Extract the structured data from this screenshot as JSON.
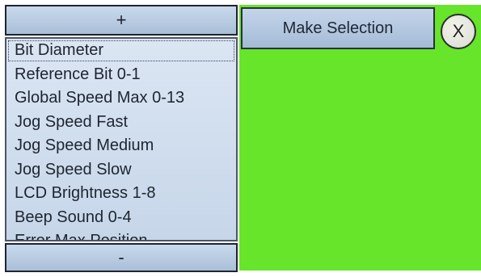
{
  "list": {
    "scroll_up_label": "+",
    "scroll_down_label": "-",
    "items": [
      {
        "label": "Bit Diameter"
      },
      {
        "label": "Reference Bit 0-1"
      },
      {
        "label": "Global Speed Max 0-13"
      },
      {
        "label": "Jog Speed Fast"
      },
      {
        "label": "Jog Speed Medium"
      },
      {
        "label": "Jog Speed Slow"
      },
      {
        "label": "LCD Brightness 1-8"
      },
      {
        "label": "Beep Sound 0-4"
      },
      {
        "label": "Error Max Position"
      }
    ]
  },
  "make_selection_label": "Make Selection",
  "close_label": "X",
  "colors": {
    "background_green": "#66e52a",
    "button_blue": "#b7cae2"
  }
}
